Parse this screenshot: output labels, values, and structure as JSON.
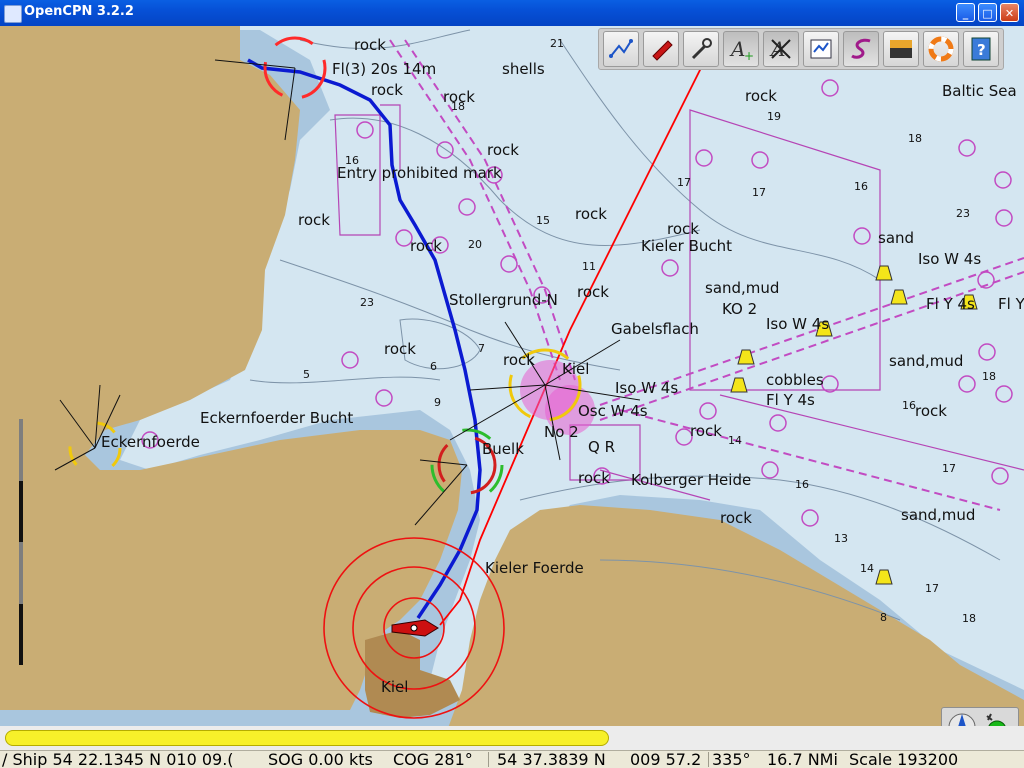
{
  "window": {
    "title": "OpenCPN 3.2.2"
  },
  "toolbar": [
    {
      "name": "route-tool-button",
      "icon": "route-icon",
      "active": false
    },
    {
      "name": "follow-ship-button",
      "icon": "ship-icon",
      "active": false
    },
    {
      "name": "settings-button",
      "icon": "wrench-icon",
      "active": false
    },
    {
      "name": "add-text-button",
      "icon": "text-add-icon",
      "active": true
    },
    {
      "name": "hide-text-button",
      "icon": "text-hide-icon",
      "active": true
    },
    {
      "name": "route-manager-button",
      "icon": "route-manager-icon",
      "active": false
    },
    {
      "name": "track-button",
      "icon": "track-icon",
      "active": true
    },
    {
      "name": "color-scheme-button",
      "icon": "color-scheme-icon",
      "active": false
    },
    {
      "name": "mob-button",
      "icon": "lifebuoy-icon",
      "active": false
    },
    {
      "name": "help-button",
      "icon": "help-icon",
      "active": false
    }
  ],
  "chart_labels": [
    "rock",
    "shells",
    "Fl(3) 20s 14m",
    "rock",
    "rock",
    "Entry prohibited mark",
    "rock",
    "rock",
    "rock",
    "rock",
    "Kieler Bucht",
    "rock",
    "rock",
    "sand",
    "Iso W 4s",
    "sand,mud",
    "Stollergrund-N",
    "rock",
    "KO 2",
    "Iso W 4s",
    "Fl Y 4s",
    "Fl Y",
    "Gabelsflach",
    "rock",
    "rock",
    "Kiel",
    "Iso W 4s",
    "cobbles",
    "Fl Y 4s",
    "sand,mud",
    "Osc W 4s",
    "rock",
    "rock",
    "Eckernfoerder Bucht",
    "Eckernfoerde",
    "rock",
    "No 2",
    "Q R",
    "Buelk",
    "Kolberger Heide",
    "rock",
    "sand,mud",
    "Kieler Foerde",
    "Kiel",
    "Baltic Sea"
  ],
  "depths": [
    "21",
    "19",
    "18",
    "17",
    "16",
    "15",
    "23",
    "20",
    "11",
    "18",
    "17",
    "16",
    "14",
    "7",
    "6",
    "5",
    "9",
    "17",
    "16",
    "14",
    "13",
    "8",
    "23",
    "18",
    "16",
    "17",
    "18"
  ],
  "status": {
    "ship": "/ Ship 54 22.1345 N   010 09.(",
    "sog": "SOG 0.00 kts",
    "cog": "COG 281°",
    "cursor": "54 37.3839 N",
    "cursor_lon": "009 57.2",
    "bearing": "335°",
    "distance": "16.7 NMi",
    "scale": "Scale 193200"
  },
  "progress": {
    "value": 0.59
  },
  "colors": {
    "land": "#c9ad74",
    "shallow": "#a9c6de",
    "water": "#d4e6f1",
    "route": "#0b1ad1",
    "track": "#ff0000"
  }
}
